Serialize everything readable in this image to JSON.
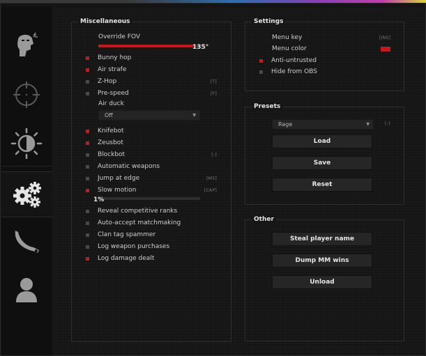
{
  "colors": {
    "accent": "#d0141a",
    "unchecked": "#4a4a4a",
    "background": "#161616"
  },
  "sidebar": {
    "tabs": [
      {
        "icon": "masked-head-icon",
        "active": false
      },
      {
        "icon": "crosshair-icon",
        "active": false
      },
      {
        "icon": "brightness-icon",
        "active": false
      },
      {
        "icon": "gears-icon",
        "active": true
      },
      {
        "icon": "karambit-knife-icon",
        "active": false
      },
      {
        "icon": "user-icon",
        "active": false
      }
    ]
  },
  "misc": {
    "title": "Miscellaneous",
    "fov": {
      "label": "Override FOV",
      "value_text": "135°",
      "fraction": 0.93
    },
    "items_a": [
      {
        "label": "Bunny hop",
        "checked": true,
        "key": ""
      },
      {
        "label": "Air strafe",
        "checked": true,
        "key": ""
      },
      {
        "label": "Z-Hop",
        "checked": false,
        "key": "[T]"
      },
      {
        "label": "Pre-speed",
        "checked": false,
        "key": "[F]"
      }
    ],
    "air_duck": {
      "label": "Air duck",
      "value": "Off"
    },
    "items_b": [
      {
        "label": "Knifebot",
        "checked": true,
        "key": ""
      },
      {
        "label": "Zeusbot",
        "checked": true,
        "key": ""
      },
      {
        "label": "Blockbot",
        "checked": false,
        "key": "[-]"
      },
      {
        "label": "Automatic weapons",
        "checked": false,
        "key": ""
      },
      {
        "label": "Jump at edge",
        "checked": false,
        "key": "[M5]"
      },
      {
        "label": "Slow motion",
        "checked": true,
        "key": "[CAP]"
      }
    ],
    "slowmo": {
      "value_text": "1%",
      "fraction": 0.0
    },
    "items_c": [
      {
        "label": "Reveal competitive ranks",
        "checked": false
      },
      {
        "label": "Auto-accept matchmaking",
        "checked": false
      },
      {
        "label": "Clan tag spammer",
        "checked": false
      },
      {
        "label": "Log weapon purchases",
        "checked": false
      },
      {
        "label": "Log damage dealt",
        "checked": true
      }
    ]
  },
  "settings": {
    "title": "Settings",
    "menu_key": {
      "label": "Menu key",
      "key": "[INS]"
    },
    "menu_color": {
      "label": "Menu color",
      "color": "#d0141a"
    },
    "anti_untrusted": {
      "label": "Anti-untrusted",
      "checked": true
    },
    "hide_obs": {
      "label": "Hide from OBS",
      "checked": false
    }
  },
  "presets": {
    "title": "Presets",
    "selected": "Rage",
    "key": "[-]",
    "buttons": [
      "Load",
      "Save",
      "Reset"
    ]
  },
  "other": {
    "title": "Other",
    "buttons": [
      "Steal player name",
      "Dump MM wins",
      "Unload"
    ]
  }
}
